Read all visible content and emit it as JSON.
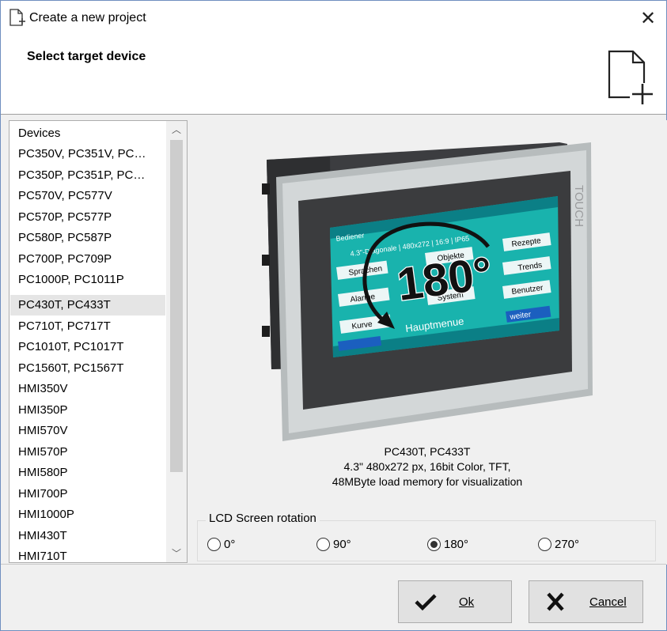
{
  "window": {
    "title": "Create a new project",
    "close_glyph": "✕"
  },
  "header": {
    "title": "Select target device"
  },
  "device_list": {
    "header": "Devices",
    "items": [
      "PC350V, PC351V, PC…",
      "PC350P, PC351P, PC…",
      "PC570V, PC577V",
      "PC570P, PC577P",
      "PC580P, PC587P",
      "PC700P, PC709P",
      "PC1000P, PC1011P",
      "PC430T, PC433T",
      "PC710T, PC717T",
      "PC1010T, PC1017T",
      "PC1560T, PC1567T",
      "HMI350V",
      "HMI350P",
      "HMI570V",
      "HMI570P",
      "HMI580P",
      "HMI700P",
      "HMI1000P",
      "HMI430T",
      "HMI710T"
    ],
    "selected": "PC430T, PC433T"
  },
  "preview": {
    "screen_labels": {
      "brand": "TOUCH",
      "rotation_text": "180°",
      "menu_title": "Hauptmenue",
      "user": "Bediener",
      "btn_sprachen": "Sprachen",
      "btn_alarme": "Alarme",
      "btn_kurve": "Kurve",
      "btn_objekte": "Objekte",
      "btn_system": "System",
      "btn_rezepte": "Rezepte",
      "btn_trends": "Trends",
      "btn_benutzer": "Benutzer",
      "btn_weiter": "weiter",
      "info": "4.3\"-Diagonale | 480x272 | 16:9 | IP65"
    },
    "desc_line1": "PC430T, PC433T",
    "desc_line2": "4.3\" 480x272 px, 16bit Color, TFT,",
    "desc_line3": "48MByte load memory for visualization"
  },
  "rotation": {
    "legend": "LCD Screen rotation",
    "options": [
      "0°",
      "90°",
      "180°",
      "270°"
    ],
    "selected": "180°"
  },
  "buttons": {
    "ok_label": "Ok",
    "cancel_label": "Cancel"
  }
}
